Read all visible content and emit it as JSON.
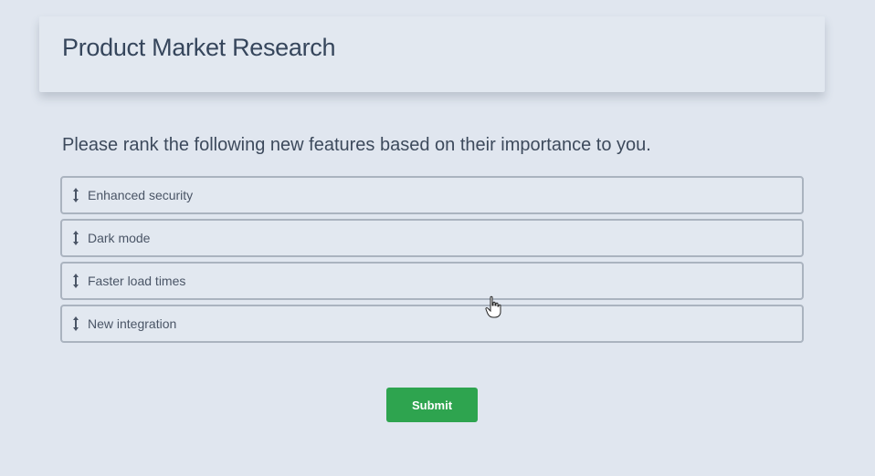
{
  "header": {
    "title": "Product Market Research"
  },
  "question": {
    "text": "Please rank the following new features based on their importance to you."
  },
  "rank_items": [
    {
      "label": "Enhanced security",
      "icon": "drag-handle-icon"
    },
    {
      "label": "Dark mode",
      "icon": "drag-handle-icon"
    },
    {
      "label": "Faster load times",
      "icon": "drag-handle-icon"
    },
    {
      "label": "New integration",
      "icon": "drag-handle-icon"
    }
  ],
  "submit": {
    "label": "Submit"
  },
  "colors": {
    "background": "#e0e6ef",
    "submit": "#2ea44f",
    "border": "#aab3bf",
    "text": "#3d4a5c"
  }
}
